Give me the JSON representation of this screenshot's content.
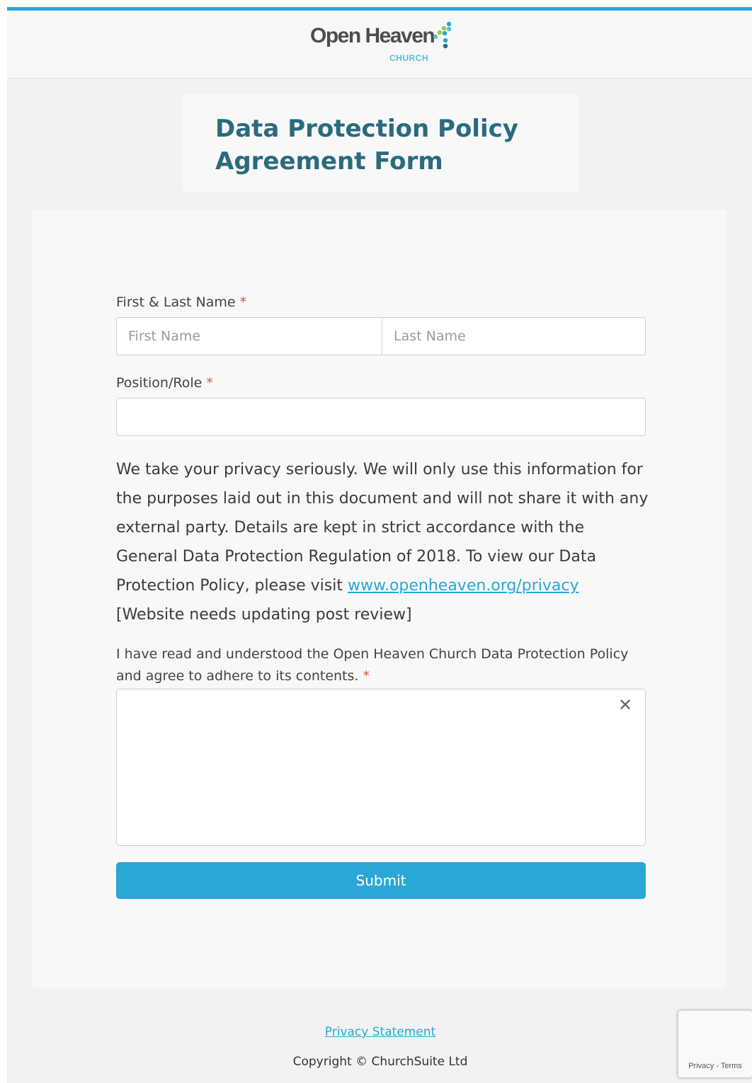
{
  "brand": {
    "logo_text": "Open Heaven",
    "logo_sub": "CHURCH",
    "accent_color": "#2aa7d6",
    "title_color": "#2b6a7f"
  },
  "form": {
    "title": "Data Protection Policy Agreement Form",
    "name_label": "First & Last Name",
    "first_name_placeholder": "First Name",
    "last_name_placeholder": "Last Name",
    "role_label": "Position/Role",
    "required_marker": "*",
    "privacy_text_before": "We take your privacy seriously. We will only use this information for the purposes laid out in this document and will not share it with any external party. Details are kept in strict accordance with the General Data Protection Regulation of 2018. To view our Data Protection Policy, please visit ",
    "privacy_link": "www.openheaven.org/privacy",
    "privacy_text_after": " [Website needs updating post review]",
    "agree_label": "I have read and understood the Open Heaven Church Data Protection Policy and agree to adhere to its contents.",
    "signature_clear_glyph": "✕",
    "submit_label": "Submit"
  },
  "footer": {
    "privacy_statement": "Privacy Statement",
    "copyright": "Copyright © ChurchSuite Ltd"
  },
  "recaptcha": {
    "privacy": "Privacy",
    "separator": " - ",
    "terms": "Terms"
  }
}
